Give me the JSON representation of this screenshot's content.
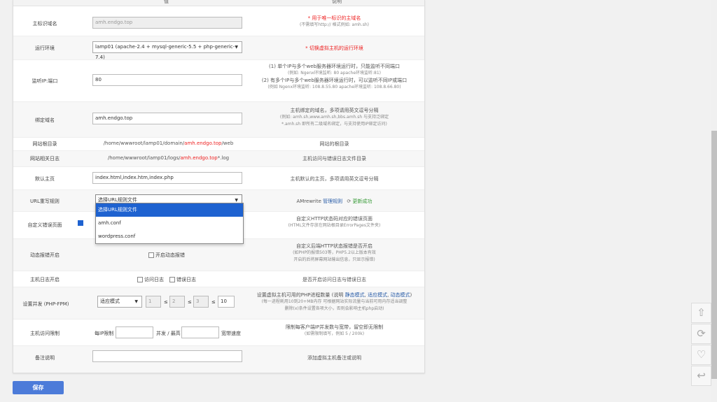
{
  "header": {
    "col_value": "值",
    "col_desc": "说明"
  },
  "rows": {
    "main_domain": {
      "label": "主标识域名",
      "value": "amh.endgo.top",
      "desc1": "* 用于唯一标识的主域名",
      "desc2": "(不需填写http:// 格式例如: amh.sh)"
    },
    "runtime": {
      "label": "运行环境",
      "value": "lamp01 (apache-2.4 + mysql-generic-5.5 + php-generic-7.4)",
      "desc": "* 切换虚拟主机的运行环境"
    },
    "listen_port": {
      "label": "监听IP:端口",
      "value": "80",
      "desc1": "(1) 单个IP与多个web服务器环境运行时，只能监听不同端口",
      "desc2": "(例如: Ngenx环境监听: 80   apache环境监听:81)",
      "desc3": "(2) 有多个IP与多个web服务器环境运行时，可以监听不同IP或端口",
      "desc4": "(例如 Ngenx环境监听: 108.8.55.80   apache环境监听: 108.8.66.80)"
    },
    "bind_domain": {
      "label": "绑定域名",
      "value": "amh.endgo.top",
      "desc1": "主机绑定的域名，多项请用英文逗号分隔",
      "desc2": "(例如: amh.sh,www.amh.sh,bbs.amh.sh 与支持泛绑定",
      "desc3": "*.amh.sh 即所有二级域名绑定，与支持使用IP绑定访问)"
    },
    "web_root": {
      "label": "网站根目录",
      "path_pre": "/home/wwwroot/lamp01/domain/",
      "path_red": "amh.endgo.top",
      "path_post": "/web",
      "desc": "网站的根目录"
    },
    "log_dir": {
      "label": "网站相关日志",
      "path_pre": "/home/wwwroot/lamp01/logs/",
      "path_red": "amh.endgo.top",
      "path_post": "*.log",
      "desc": "主机访问与错误日志文件目录"
    },
    "default_page": {
      "label": "默认主页",
      "value": "index.html,index.htm,index.php",
      "desc": "主机默认的主页，多项请用英文逗号分隔"
    },
    "url_rewrite": {
      "label": "URL重写规则",
      "value": "选择URL规则文件",
      "desc_pre": "AMrewrite",
      "desc_link": "管理规则",
      "desc_refresh": "更新成功"
    },
    "error_page": {
      "label": "自定义错误页面",
      "desc1": "自定义HTTP状态码对应的错误页面",
      "desc2": "(HTML文件存放在网站根目录ErrorPages文件夹)"
    },
    "dynamic_error": {
      "label": "动态报错开启",
      "checkbox_label": "开启动态报错",
      "desc1": "自定义后端HTTP状态报错是否开启",
      "desc2": "(如PHP的报错503等，PHP5.2以上版本有效",
      "desc3": "开启的后将屏幕网站输出信息，只显示报错)"
    },
    "host_log": {
      "label": "主机日志开启",
      "chk1": "访问日志",
      "chk2": "错误日志",
      "desc": "是否开启访问日志与错误日志"
    },
    "concurrency": {
      "label": "设置并发 (PHP-FPM)",
      "mode": "适应模式",
      "v1": "1",
      "v2": "2",
      "v3": "3",
      "v4": "10",
      "le": "≤",
      "desc_pre": "设置虚拟主机可用的PHP进程数量 (说明",
      "desc_m1": "静态模式",
      "desc_m2": "适应模式",
      "desc_m3": "动态模式",
      "desc_post": ")",
      "desc2": "(每一进程耗用10到20+MB内存 可根据网站实际流量与当前可用内存适当调整",
      "desc3": "删除(x)条件设置各项大小，否则会影响主机php启动)"
    },
    "access_limit": {
      "label": "主机访问限制",
      "pre": "每IP限制",
      "mid": "并发 / 最高",
      "post": "宽带速度",
      "desc1": "限制每客户端IP并发数与宽带，留空即无限制",
      "desc2": "(如需限制填写，例如 5 / 200k)"
    },
    "remark": {
      "label": "备注说明",
      "desc": "添加虚拟主机备注或说明"
    }
  },
  "dropdown": {
    "options": [
      "选择URL规则文件",
      "amh.conf",
      "wordpress.conf"
    ],
    "selected": "选择URL规则文件"
  },
  "save_label": "保存",
  "float_buttons": [
    "back-to-top-icon",
    "refresh-icon",
    "favorite-icon",
    "return-icon"
  ],
  "colors": {
    "accent": "#4c7bd9",
    "highlight": "#1e62d0",
    "required": "#ee2222"
  }
}
